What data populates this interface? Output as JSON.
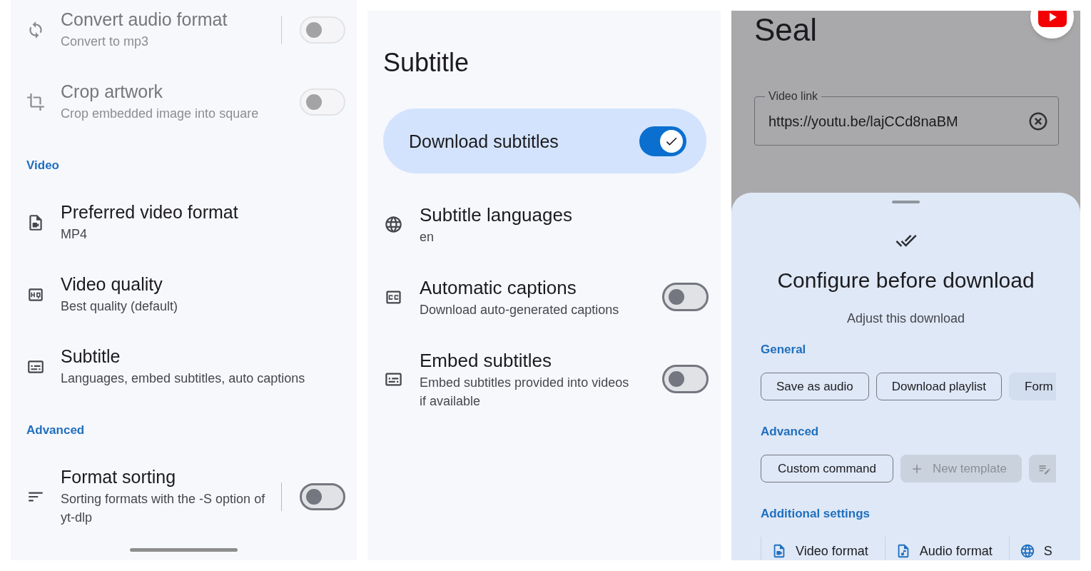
{
  "settings_screen": {
    "items": [
      {
        "kind": "split_switch",
        "title": "Convert audio format",
        "subtitle": "Convert to mp3",
        "disabled": true,
        "on": false
      },
      {
        "kind": "switch",
        "title": "Crop artwork",
        "subtitle": "Crop embedded image into square",
        "disabled": true,
        "on": false
      },
      {
        "kind": "header",
        "title": "Video"
      },
      {
        "kind": "link",
        "title": "Preferred video format",
        "subtitle": "MP4",
        "disabled": false
      },
      {
        "kind": "link",
        "title": "Video quality",
        "subtitle": "Best quality (default)",
        "disabled": false
      },
      {
        "kind": "link",
        "title": "Subtitle",
        "subtitle": "Languages, embed subtitles, auto captions",
        "disabled": false
      },
      {
        "kind": "header",
        "title": "Advanced"
      },
      {
        "kind": "split_switch",
        "title": "Format sorting",
        "subtitle": "Sorting formats with the -S option of yt-dlp",
        "disabled": false,
        "on": false
      }
    ]
  },
  "subtitle_screen": {
    "title": "Subtitle",
    "main_switch": {
      "label": "Download subtitles",
      "on": true
    },
    "items": [
      {
        "kind": "link",
        "title": "Subtitle languages",
        "subtitle": "en"
      },
      {
        "kind": "switch",
        "title": "Automatic captions",
        "subtitle": "Download auto-generated captions",
        "on": false
      },
      {
        "kind": "switch",
        "title": "Embed subtitles",
        "subtitle": "Embed subtitles provided into videos if available",
        "on": false
      }
    ]
  },
  "download_screen": {
    "app_title": "Seal",
    "video_link_field": {
      "label": "Video link",
      "value": "https://youtu.be/lajCCd8naBM"
    },
    "sheet": {
      "title": "Configure before download",
      "subtitle": "Adjust this download",
      "sections": [
        {
          "kind": "chips",
          "title": "General",
          "chips": [
            {
              "kind": "filter",
              "label": "Save as audio",
              "selected": false
            },
            {
              "kind": "filter",
              "label": "Download playlist",
              "selected": false
            },
            {
              "kind": "filter",
              "label": "Form",
              "selected": true
            }
          ]
        },
        {
          "kind": "chips",
          "title": "Advanced",
          "chips": [
            {
              "kind": "assist",
              "label": "Custom command",
              "disabled": false
            },
            {
              "kind": "template",
              "label": "New template",
              "disabled": true
            },
            {
              "kind": "icon",
              "disabled": true
            }
          ]
        },
        {
          "kind": "buttons",
          "title": "Additional settings",
          "items": [
            {
              "label": "Video format"
            },
            {
              "label": "Audio format"
            },
            {
              "label": "S"
            }
          ]
        }
      ]
    }
  }
}
